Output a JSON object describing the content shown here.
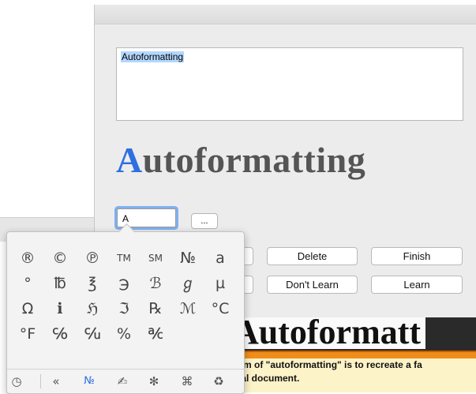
{
  "text_area": {
    "content": "Autoformatting"
  },
  "preview": {
    "first_letter": "A",
    "rest": "utoformatting"
  },
  "char_field": {
    "value": "A"
  },
  "more_button": {
    "label": "..."
  },
  "buttons": {
    "delete": "Delete",
    "finish": "Finish",
    "dont_learn": "Don't Learn",
    "learn": "Learn"
  },
  "document_preview": {
    "title": "Autoformatt",
    "line1": "aim of \"autoformatting\" is to recreate a fa",
    "line2": "nal document."
  },
  "palette": {
    "rows": [
      [
        "®",
        "©",
        "℗",
        "TM",
        "SM",
        "№",
        "a"
      ],
      [
        "°",
        "℔",
        "℥",
        "℈",
        "ℬ",
        "ℊ",
        "µ"
      ],
      [
        "Ω",
        "ℹ",
        "ℌ",
        "ℑ",
        "℞",
        "ℳ",
        "°C"
      ],
      [
        "°F",
        "℅",
        "℆",
        "%",
        "℀"
      ]
    ],
    "categories": [
      {
        "name": "recents-icon",
        "glyph": "◷"
      },
      {
        "name": "double-angle-icon",
        "glyph": "«"
      },
      {
        "name": "numero-icon",
        "glyph": "№"
      },
      {
        "name": "pencil-icon",
        "glyph": "✍"
      },
      {
        "name": "asterisk-icon",
        "glyph": "✻"
      },
      {
        "name": "command-icon",
        "glyph": "⌘"
      },
      {
        "name": "recycle-icon",
        "glyph": "♻"
      }
    ]
  },
  "colors": {
    "accent": "#2f6fe0",
    "orange_rule": "#f08d1a"
  }
}
